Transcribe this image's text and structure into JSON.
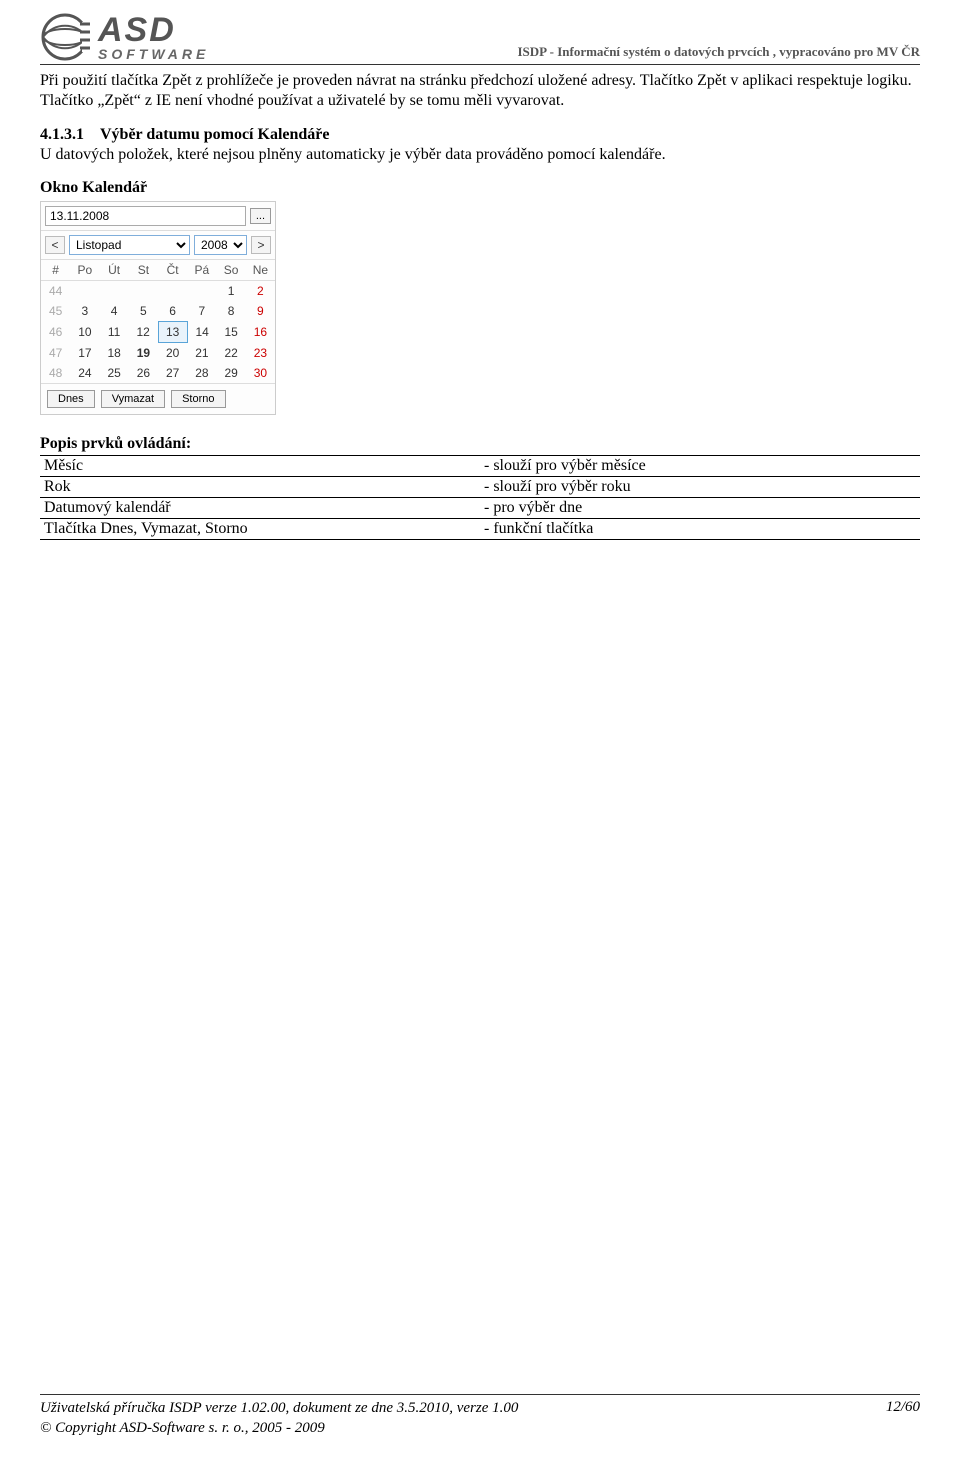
{
  "header": {
    "logo_main": "ASD",
    "logo_sub": "SOFTWARE",
    "right": "ISDP - Informační systém o datových prvcích , vypracováno pro MV ČR"
  },
  "body": {
    "para1": "Při použití tlačítka Zpět z prohlížeče je proveden návrat na stránku  předchozí uložené adresy. Tlačítko Zpět v aplikaci respektuje logiku. Tlačítko „Zpět“ z IE není vhodné používat a uživatelé by se tomu měli vyvarovat.",
    "sec_num": "4.1.3.1",
    "sec_title": "Výběr datumu pomocí Kalendáře",
    "sec_body": "U datových položek, které nejsou plněny automaticky je výběr data prováděno pomocí kalendáře.",
    "okno": "Okno Kalendář"
  },
  "calendar": {
    "date_value": "13.11.2008",
    "picker_btn": "...",
    "prev": "<",
    "next": ">",
    "month": "Listopad",
    "year": "2008",
    "dow": [
      "#",
      "Po",
      "Út",
      "St",
      "Čt",
      "Pá",
      "So",
      "Ne"
    ],
    "rows": [
      {
        "wk": "44",
        "d": [
          "",
          "",
          "",
          "",
          "",
          "1",
          "2"
        ]
      },
      {
        "wk": "45",
        "d": [
          "3",
          "4",
          "5",
          "6",
          "7",
          "8",
          "9"
        ]
      },
      {
        "wk": "46",
        "d": [
          "10",
          "11",
          "12",
          "13",
          "14",
          "15",
          "16"
        ]
      },
      {
        "wk": "47",
        "d": [
          "17",
          "18",
          "19",
          "20",
          "21",
          "22",
          "23"
        ]
      },
      {
        "wk": "48",
        "d": [
          "24",
          "25",
          "26",
          "27",
          "28",
          "29",
          "30"
        ]
      }
    ],
    "btn_today": "Dnes",
    "btn_clear": "Vymazat",
    "btn_cancel": "Storno",
    "today_label": "19",
    "selected_label": "13"
  },
  "desc": {
    "title": "Popis prvků ovládání:",
    "rows": [
      {
        "l": "Měsíc",
        "r": "- slouží pro výběr měsíce"
      },
      {
        "l": "Rok",
        "r": "- slouží pro výběr roku"
      },
      {
        "l": "Datumový kalendář",
        "r": "- pro výběr dne"
      },
      {
        "l": "Tlačítka Dnes, Vymazat, Storno",
        "r": "- funkční tlačítka"
      }
    ]
  },
  "footer": {
    "line1": "Uživatelská  příručka ISDP verze 1.02.00, dokument ze dne 3.5.2010, verze 1.00",
    "line2": "© Copyright ASD-Software s. r. o., 2005 - 2009",
    "page": "12/60"
  }
}
